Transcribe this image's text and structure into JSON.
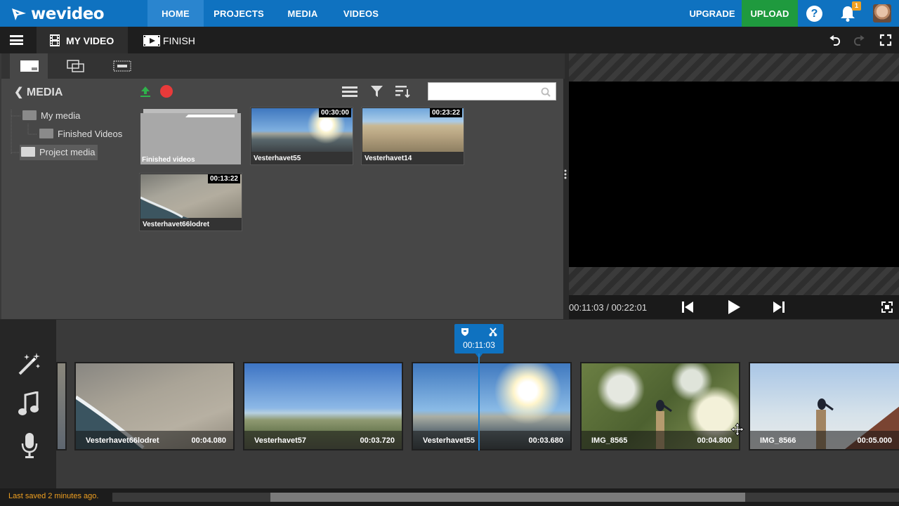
{
  "app": {
    "brand": "wevideo"
  },
  "nav": {
    "home": "HOME",
    "projects": "PROJECTS",
    "media": "MEDIA",
    "videos": "VIDEOS",
    "upgrade": "UPGRADE",
    "upload": "UPLOAD",
    "help": "?",
    "notifications_count": "1"
  },
  "editor": {
    "tab_myvideo": "MY VIDEO",
    "tab_finish": "FINISH"
  },
  "media": {
    "title": "MEDIA",
    "search": {
      "value": "",
      "placeholder": ""
    },
    "tree": [
      {
        "label": "My media"
      },
      {
        "label": "Finished Videos"
      },
      {
        "label": "Project media"
      }
    ],
    "items": [
      {
        "name": "Finished videos",
        "duration": ""
      },
      {
        "name": "Vesterhavet55",
        "duration": "00:30:00"
      },
      {
        "name": "Vesterhavet14",
        "duration": "00:23:22"
      },
      {
        "name": "Vesterhavet66lodret",
        "duration": "00:13:22"
      }
    ]
  },
  "preview": {
    "timecode": "00:11:03 / 00:22:01"
  },
  "timeline": {
    "playhead": "00:11:03",
    "clips": [
      {
        "name": "Vesterhavet66lodret",
        "duration": "00:04.080"
      },
      {
        "name": "Vesterhavet57",
        "duration": "00:03.720"
      },
      {
        "name": "Vesterhavet55",
        "duration": "00:03.680"
      },
      {
        "name": "IMG_8565",
        "duration": "00:04.800"
      },
      {
        "name": "IMG_8566",
        "duration": "00:05.000"
      }
    ]
  },
  "status": {
    "saved": "Last saved 2 minutes ago."
  },
  "colors": {
    "brand": "#0f72c0",
    "upload": "#1f9a3e",
    "record": "#e83a3a",
    "saved": "#f0a020"
  }
}
